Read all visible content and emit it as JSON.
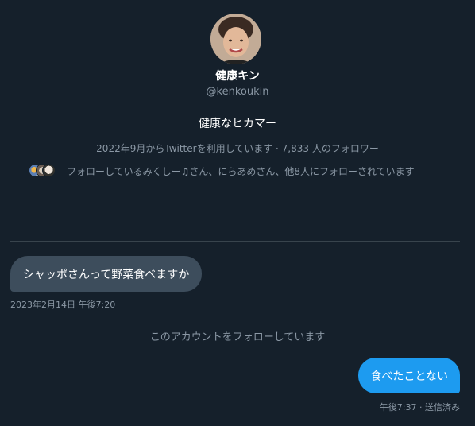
{
  "profile": {
    "display_name": "健康キン",
    "handle": "@kenkoukin",
    "bio": "健康なヒカマー",
    "meta": "2022年9月からTwitterを利用しています · 7,833 人のフォロワー",
    "followed_by": "フォローしているみくしー♫さん、にらあめさん、他8人にフォローされています"
  },
  "conversation": {
    "received_message": "シャッポさんって野菜食べますか",
    "received_timestamp": "2023年2月14日 午後7:20",
    "follow_notice": "このアカウントをフォローしています",
    "sent_message": "食べたことない",
    "sent_status": "午後7:37 · 送信済み"
  },
  "colors": {
    "background": "#15202b",
    "received_bubble": "#3d4d5c",
    "sent_bubble": "#1d9bf0",
    "secondary_text": "#8b98a5",
    "divider": "#38444d"
  }
}
